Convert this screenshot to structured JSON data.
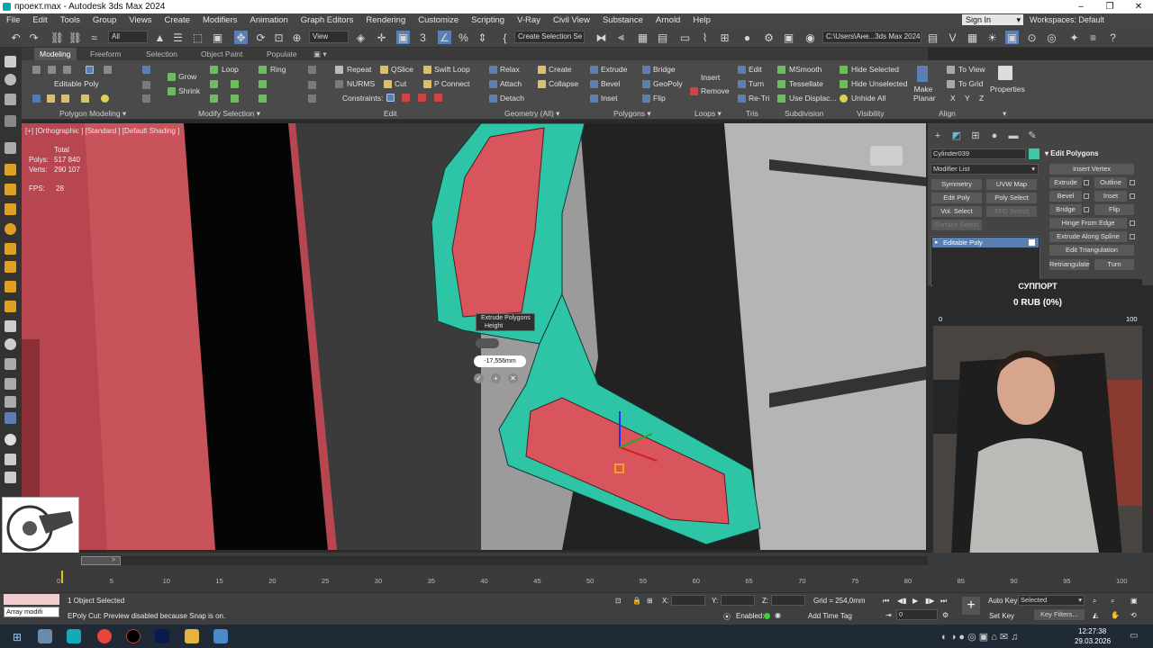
{
  "window": {
    "title": "проект.max - Autodesk 3ds Max 2024",
    "min": "–",
    "restore": "❐",
    "close": "✕"
  },
  "menu": [
    "File",
    "Edit",
    "Tools",
    "Group",
    "Views",
    "Create",
    "Modifiers",
    "Animation",
    "Graph Editors",
    "Rendering",
    "Customize",
    "Scripting",
    "V-Ray",
    "Civil View",
    "Substance",
    "Arnold",
    "Help"
  ],
  "account": {
    "sign_in": "Sign In",
    "workspaces_label": "Workspaces:",
    "workspace": "Default"
  },
  "toolbar": {
    "filter": "All",
    "view": "View",
    "selection_set": "Create Selection Se",
    "path": "C:\\Users\\Ане...3ds Max 2024"
  },
  "ribbon": {
    "tabs": [
      "Modeling",
      "Freeform",
      "Selection",
      "Object Paint",
      "Populate"
    ],
    "active_tab": "Modeling",
    "editable_poly": "Editable Poly",
    "grow": "Grow",
    "shrink": "Shrink",
    "loop": "Loop",
    "ring": "Ring",
    "repeat": "Repeat",
    "qslice": "QSlice",
    "swift_loop": "Swift Loop",
    "nurms": "NURMS",
    "cut": "Cut",
    "p_connect": "P Connect",
    "constraints": "Constraints:",
    "relax": "Relax",
    "create": "Create",
    "attach": "Attach",
    "collapse": "Collapse",
    "detach": "Detach",
    "extrude": "Extrude",
    "bridge": "Bridge",
    "bevel": "Bevel",
    "geopoly": "GeoPoly",
    "inset": "Inset",
    "flip": "Flip",
    "insert": "Insert",
    "remove": "Remove",
    "edit": "Edit",
    "turn": "Turn",
    "re_tri": "Re-Tri",
    "msmooth": "MSmooth",
    "tessellate": "Tessellate",
    "use_displac": "Use Displac...",
    "hide_selected": "Hide Selected",
    "hide_unselected": "Hide Unselected",
    "unhide_all": "Unhide All",
    "make_planar": "Make Planar",
    "to_view": "To View",
    "to_grid": "To Grid",
    "x": "X",
    "y": "Y",
    "z": "Z",
    "properties": "Properties",
    "groups": [
      "Polygon Modeling ▾",
      "Modify Selection ▾",
      "Edit",
      "Geometry (All) ▾",
      "Polygons ▾",
      "Loops ▾",
      "Tris",
      "Subdivision",
      "Visibility",
      "Align"
    ]
  },
  "viewport": {
    "label": "[+] [Orthographic ] [Standard ] [Default Shading ]",
    "stats": {
      "total": "Total",
      "polys_label": "Polys:",
      "polys": "517 840",
      "verts_label": "Verts:",
      "verts": "290 107",
      "fps_label": "FPS:",
      "fps": "28"
    },
    "caddy": {
      "title": "Extrude Polygons",
      "sub": "Height",
      "value": "-17,556mm"
    }
  },
  "command_panel": {
    "object_name": "Cylinder039",
    "modifier_list": "Modifier List",
    "buttons": [
      "Symmetry",
      "UVW Map",
      "Edit Poly",
      "Poly Select",
      "Vol. Select",
      "FFD Select",
      "Surface Select"
    ],
    "stack_item": "Editable Poly",
    "rollout_title": "Edit Polygons",
    "rollout": {
      "insert_vertex": "Insert Vertex",
      "extrude": "Extrude",
      "outline": "Outline",
      "bevel": "Bevel",
      "inset": "Inset",
      "bridge": "Bridge",
      "flip": "Flip",
      "hinge": "Hinge From Edge",
      "extrude_spline": "Extrude Along Spline",
      "edit_tri": "Edit Triangulation",
      "retriangulate": "Retriangulate",
      "turn": "Turn"
    }
  },
  "donation": {
    "title": "СУППОРТ",
    "amount": "0 RUB (0%)",
    "min": "0",
    "max": "100"
  },
  "timeline": {
    "frame": "0 / 100",
    "ticks": [
      "0",
      "5",
      "10",
      "15",
      "20",
      "25",
      "30",
      "35",
      "40",
      "45",
      "50",
      "55",
      "60",
      "65",
      "70",
      "75",
      "80",
      "85",
      "90",
      "95",
      "100"
    ]
  },
  "status": {
    "selected": "1 Object Selected",
    "prompt": "EPoly Cut: Preview disabled because Snap is on.",
    "maxscript": "Array modifi",
    "x_label": "X:",
    "y_label": "Y:",
    "z_label": "Z:",
    "grid": "Grid = 254,0mm",
    "enabled": "Enabled:",
    "add_time_tag": "Add Time Tag",
    "auto_key": "Auto Key",
    "set_key": "Set Key",
    "selected_dropdown": "Selected",
    "key_filters": "Key Filters...",
    "frame_field": "0"
  },
  "taskbar": {
    "time": "12:27:38",
    "date": "29.03.2026"
  }
}
